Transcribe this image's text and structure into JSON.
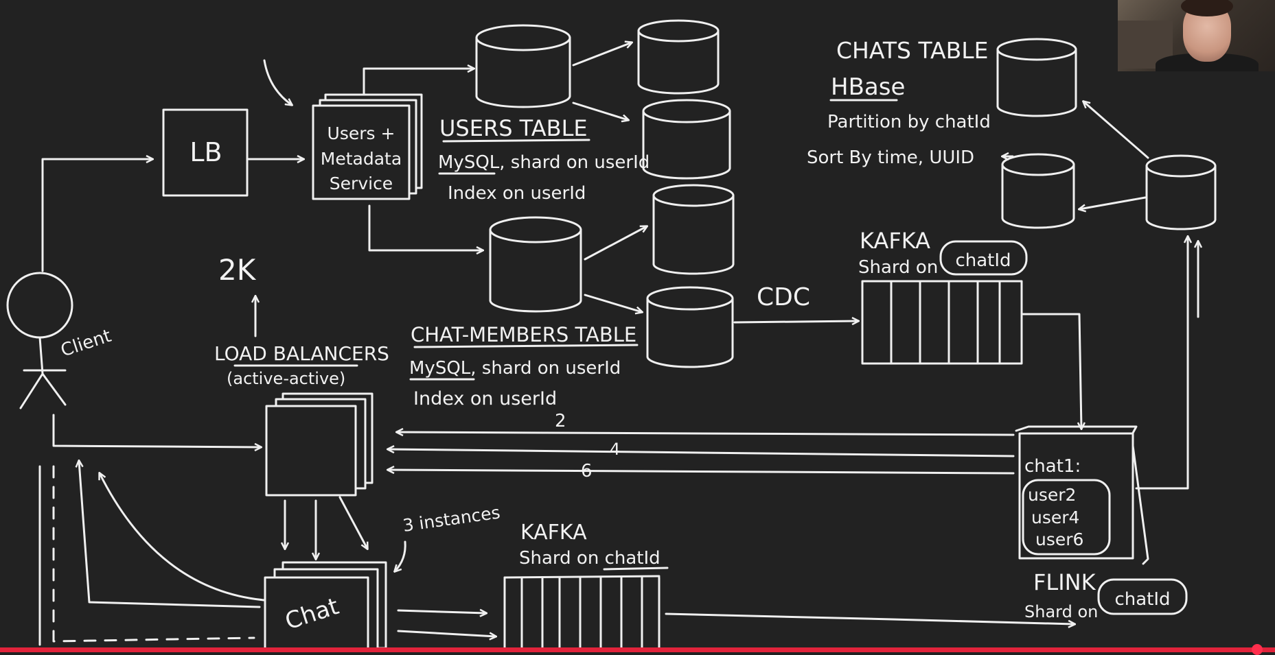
{
  "diagram": {
    "components": {
      "lb": "LB",
      "users_service": [
        "Users +",
        "Metadata",
        "Service"
      ],
      "load_balancers": [
        "LOAD BALANCERS",
        "(active-active)"
      ],
      "chat_service": "Chat",
      "kafka_flink": [
        "KAFKA",
        "Shard on",
        "chatId"
      ],
      "kafka_chat": [
        "KAFKA",
        "Shard on chatId"
      ],
      "flink": [
        "FLINK",
        "Shard on",
        "chatId"
      ],
      "flink_state": [
        "chat1:",
        "user2",
        "user4",
        "user6"
      ]
    },
    "notes": {
      "users_table": [
        "USERS TABLE",
        "MySQL, shard on userId",
        "Index on userId"
      ],
      "chat_members_table": [
        "CHAT-MEMBERS TABLE",
        "MySQL, shard on userId",
        "Index on userId"
      ],
      "chats_table": [
        "CHATS TABLE",
        "HBase",
        "Partition by chatId",
        "Sort By time, UUID"
      ],
      "cdc": "CDC",
      "scale": "2K",
      "instances": "3 instances",
      "client": "Client"
    },
    "edge_labels": [
      "2",
      "4",
      "6"
    ]
  },
  "video": {
    "presenter": "webcam",
    "progress": 0.98
  }
}
